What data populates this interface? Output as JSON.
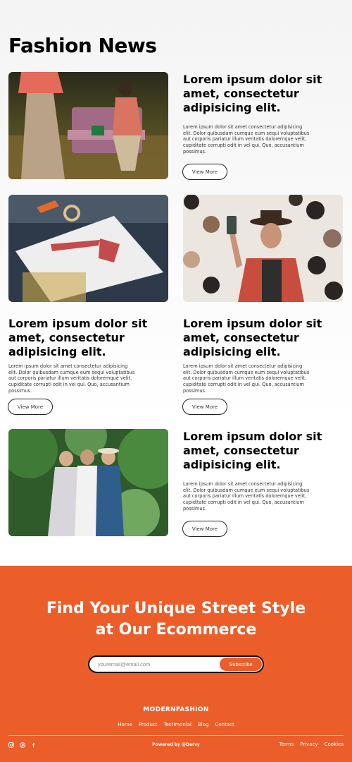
{
  "header": {
    "title": "Fashion News"
  },
  "cards": [
    {
      "title": "Lorem ipsum dolor sit amet, consectetur adipisicing elit.",
      "body": "Lorem ipsum dolor sit amet consectetur adipisicing elit. Dolor quibusdam cumque eum sequi voluptatibus aut corporis pariatur illum veritatis doloremque velit, cupiditate corrupti odit in vel qui. Quo, accusantium possimus.",
      "button": "View More",
      "image": "woman-on-floral-bench-photo"
    },
    {
      "title": "Lorem ipsum dolor sit amet, consectetur adipisicing elit.",
      "body": "Lorem ipsum dolor sit amet consectetur adipisicing elit. Dolor quibusdam cumque eum sequi voluptatibus aut corporis pariatur illum veritatis doloremque velit, cupiditate corrupti odit in vel qui. Quo, accusantium possimus.",
      "button": "View More",
      "image": "fashion-sketch-photo"
    },
    {
      "title": "Lorem ipsum dolor sit amet, consectetur adipisicing elit.",
      "body": "Lorem ipsum dolor sit amet consectetur adipisicing elit. Dolor quibusdam cumque eum sequi voluptatibus aut corporis pariatur illum veritatis doloremque velit, cupiditate corrupti odit in vel qui. Quo, accusantium possimus.",
      "button": "View More",
      "image": "man-selfie-hat-wall-photo"
    },
    {
      "title": "Lorem ipsum dolor sit amet, consectetur adipisicing elit.",
      "body": "Lorem ipsum dolor sit amet consectetur adipisicing elit. Dolor quibusdam cumque eum sequi voluptatibus aut corporis pariatur illum veritatis doloremque velit, cupiditate corrupti odit in vel qui. Quo, accusantium possimus.",
      "button": "View More",
      "image": "three-women-jungle-photo"
    }
  ],
  "footer": {
    "cta_line1": "Find Your Unique Street Style",
    "cta_line2": "at Our Ecommerce",
    "email_placeholder": "youremail@email.com",
    "subscribe_label": "Subscribe",
    "brand": "MODERNFASHION",
    "nav": [
      "Home",
      "Product",
      "Testimonial",
      "Blog",
      "Contact"
    ],
    "powered_by": "Powered by @Darvy",
    "legal": [
      "Terms",
      "Privacy",
      "Cookies"
    ],
    "social_icons": [
      "instagram-icon",
      "pinterest-icon",
      "facebook-icon"
    ],
    "accent_color": "#eb5e2a"
  }
}
